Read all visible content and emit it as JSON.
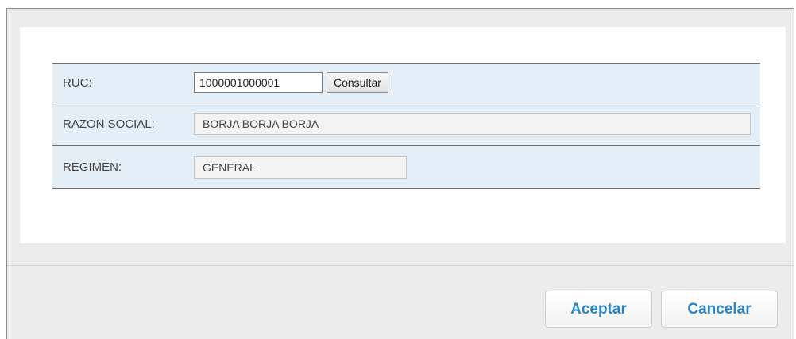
{
  "form": {
    "ruc": {
      "label": "RUC:",
      "value": "1000001000001",
      "button_label": "Consultar"
    },
    "razon_social": {
      "label": "RAZON SOCIAL:",
      "value": "BORJA BORJA BORJA"
    },
    "regimen": {
      "label": "REGIMEN:",
      "value": "GENERAL"
    }
  },
  "footer": {
    "accept_label": "Aceptar",
    "cancel_label": "Cancelar"
  },
  "colors": {
    "row_background": "#e3eef7",
    "action_text": "#2a86c4"
  }
}
